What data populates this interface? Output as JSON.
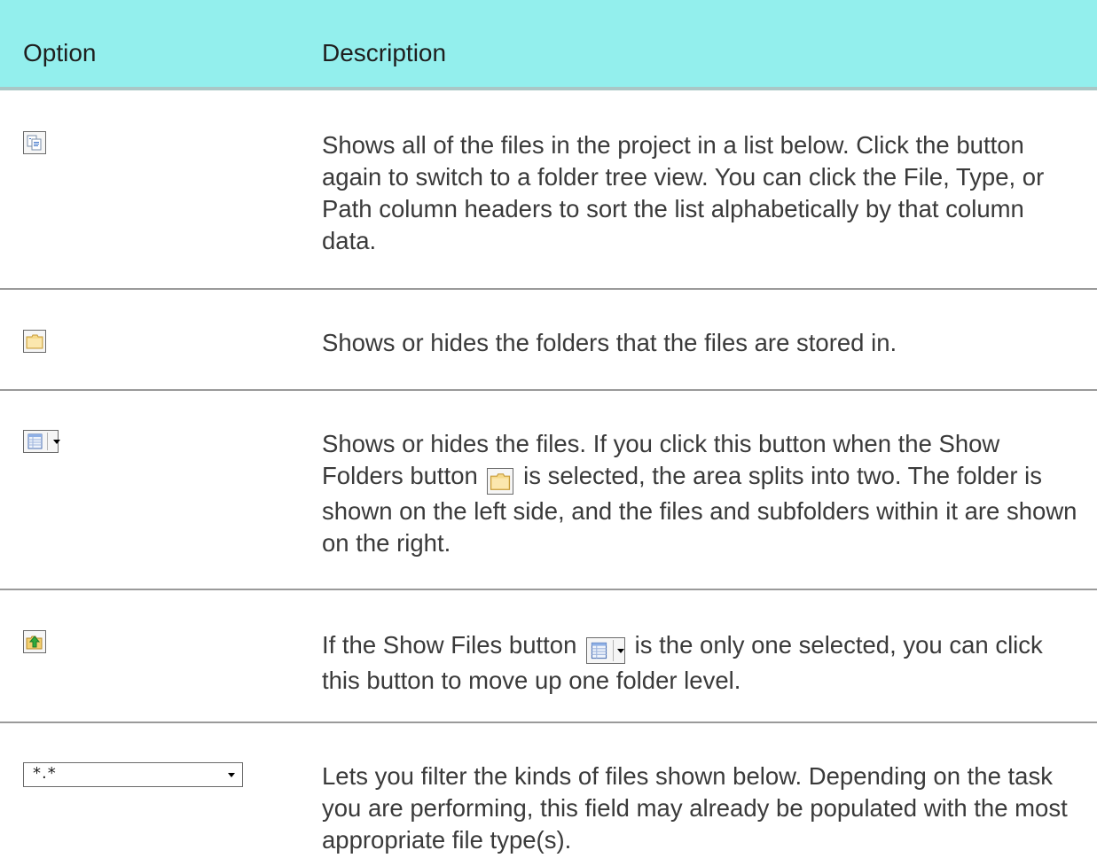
{
  "header": {
    "option": "Option",
    "description": "Description"
  },
  "rows": [
    {
      "icon": "show-all-files-icon",
      "description": "Shows all of the files in the project in a list below. Click the button again to switch to a folder tree view. You can click the File, Type, or Path column headers to sort the list alphabetically by that column data."
    },
    {
      "icon": "show-folders-icon",
      "description": "Shows or hides the folders that the files are stored in."
    },
    {
      "icon": "show-files-icon",
      "desc_part1": "Shows or hides the files. If you click this button when the Show Folders button",
      "desc_part2": "is selected, the area splits into two. The folder is shown on the left side, and the files and subfolders within it are shown on the right."
    },
    {
      "icon": "up-one-level-icon",
      "desc_part1": "If the Show Files button",
      "desc_part2": "is the only one selected, you can click this button to move up one folder level."
    },
    {
      "icon": "file-filter-dropdown",
      "filter_value": "*.*",
      "description": "Lets you filter the kinds of files shown below. Depending on the task you are performing, this field may already be populated with the most appropriate file type(s)."
    }
  ]
}
